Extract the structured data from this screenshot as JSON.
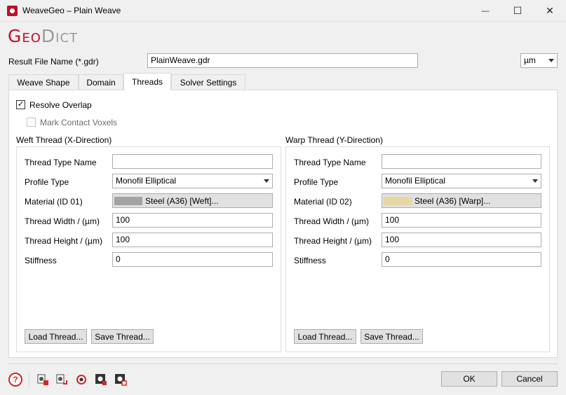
{
  "window": {
    "title": "WeaveGeo – Plain Weave",
    "minimize_glyph": "—",
    "maximize_glyph": "☐",
    "close_glyph": "✕"
  },
  "logo": {
    "geo": "Geo",
    "dict": "Dict"
  },
  "result_file": {
    "label": "Result File Name (*.gdr)",
    "value": "PlainWeave.gdr"
  },
  "unit_select": {
    "value": "µm"
  },
  "tabs": [
    {
      "label": "Weave Shape",
      "active": false
    },
    {
      "label": "Domain",
      "active": false
    },
    {
      "label": "Threads",
      "active": true
    },
    {
      "label": "Solver Settings",
      "active": false
    }
  ],
  "options": {
    "resolve_overlap": {
      "label": "Resolve Overlap",
      "checked": true
    },
    "mark_contact_voxels": {
      "label": "Mark Contact Voxels",
      "checked": false,
      "enabled": false
    }
  },
  "weft": {
    "title": "Weft Thread (X-Direction)",
    "type_name_label": "Thread Type Name",
    "type_name_value": "",
    "profile_label": "Profile Type",
    "profile_value": "Monofil Elliptical",
    "material_label": "Material (ID 01)",
    "material_value": "Steel (A36) [Weft]...",
    "material_color": "#a3a3a3",
    "width_label": "Thread Width / (µm)",
    "width_value": "100",
    "height_label": "Thread Height / (µm)",
    "height_value": "100",
    "stiffness_label": "Stiffness",
    "stiffness_value": "0",
    "load_label": "Load Thread...",
    "save_label": "Save Thread..."
  },
  "warp": {
    "title": "Warp Thread (Y-Direction)",
    "type_name_label": "Thread Type Name",
    "type_name_value": "",
    "profile_label": "Profile Type",
    "profile_value": "Monofil Elliptical",
    "material_label": "Material (ID 02)",
    "material_value": "Steel (A36) [Warp]...",
    "material_color": "#e6d7a5",
    "width_label": "Thread Width / (µm)",
    "width_value": "100",
    "height_label": "Thread Height / (µm)",
    "height_value": "100",
    "stiffness_label": "Stiffness",
    "stiffness_value": "0",
    "load_label": "Load Thread...",
    "save_label": "Save Thread..."
  },
  "footer": {
    "help_glyph": "?",
    "ok_label": "OK",
    "cancel_label": "Cancel"
  },
  "colors": {
    "brand_red": "#c0102b",
    "help_red": "#d8262b"
  }
}
